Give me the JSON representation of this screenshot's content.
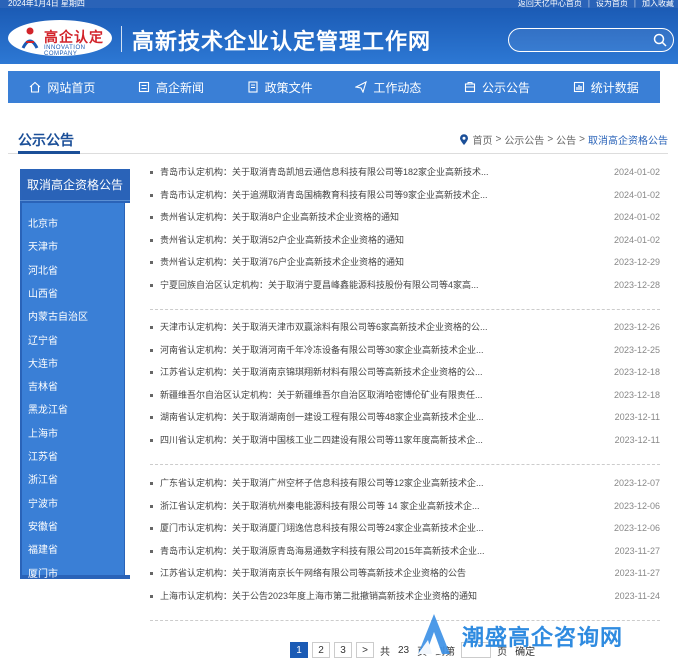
{
  "topbar": {
    "date": "2024年1月4日 星期四",
    "link_home": "返回天亿中心首页",
    "link_sethome": "设为首页",
    "link_fav": "加入收藏",
    "sep": "|"
  },
  "header": {
    "logo_text": "高企认定",
    "logo_sub": "INNOVATION COMPANY",
    "site_title": "高新技术企业认定管理工作网",
    "search_placeholder": ""
  },
  "nav": {
    "items": [
      {
        "label": "网站首页",
        "icon": "home-icon"
      },
      {
        "label": "高企新闻",
        "icon": "news-icon"
      },
      {
        "label": "政策文件",
        "icon": "document-icon"
      },
      {
        "label": "工作动态",
        "icon": "send-icon"
      },
      {
        "label": "公示公告",
        "icon": "notice-icon"
      },
      {
        "label": "统计数据",
        "icon": "chart-icon"
      }
    ]
  },
  "section": {
    "title": "公示公告",
    "breadcrumb": [
      "首页",
      "公示公告",
      "公告",
      "取消高企资格公告"
    ],
    "sep": ">"
  },
  "sidebar": {
    "head": "取消高企资格公告",
    "items": [
      "北京市",
      "天津市",
      "河北省",
      "山西省",
      "内蒙古自治区",
      "辽宁省",
      "大连市",
      "吉林省",
      "黑龙江省",
      "上海市",
      "江苏省",
      "浙江省",
      "宁波市",
      "安徽省",
      "福建省",
      "厦门市"
    ]
  },
  "list": {
    "groups": [
      [
        {
          "title": "青岛市认定机构：关于取消青岛凯旭云通信息科技有限公司等182家企业高新技术...",
          "date": "2024-01-02"
        },
        {
          "title": "青岛市认定机构：关于追溯取消青岛国楠教育科技有限公司等9家企业高新技术企...",
          "date": "2024-01-02"
        },
        {
          "title": "贵州省认定机构：关于取消8户企业高新技术企业资格的通知",
          "date": "2024-01-02"
        },
        {
          "title": "贵州省认定机构：关于取消52户企业高新技术企业资格的通知",
          "date": "2024-01-02"
        },
        {
          "title": "贵州省认定机构：关于取消76户企业高新技术企业资格的通知",
          "date": "2023-12-29"
        },
        {
          "title": "宁夏回族自治区认定机构：关于取消宁夏昌峰鑫能源科技股份有限公司等4家高...",
          "date": "2023-12-28"
        }
      ],
      [
        {
          "title": "天津市认定机构：关于取消天津市双赢涂料有限公司等6家高新技术企业资格的公...",
          "date": "2023-12-26"
        },
        {
          "title": "河南省认定机构：关于取消河南千年冷冻设备有限公司等30家企业高新技术企业...",
          "date": "2023-12-25"
        },
        {
          "title": "江苏省认定机构：关于取消南京锦琪翔新材料有限公司等高新技术企业资格的公...",
          "date": "2023-12-18"
        },
        {
          "title": "新疆维吾尔自治区认定机构：关于新疆维吾尔自治区取消哈密博伦矿业有限责任...",
          "date": "2023-12-18"
        },
        {
          "title": "湖南省认定机构：关于取消湖南创一建设工程有限公司等48家企业高新技术企业...",
          "date": "2023-12-11"
        },
        {
          "title": "四川省认定机构：关于取消中国核工业二四建设有限公司等11家年度高新技术企...",
          "date": "2023-12-11"
        }
      ],
      [
        {
          "title": "广东省认定机构：关于取消广州空杯子信息科技有限公司等12家企业高新技术企...",
          "date": "2023-12-07"
        },
        {
          "title": "浙江省认定机构：关于取消杭州秦电能源科技有限公司等 14 家企业高新技术企...",
          "date": "2023-12-06"
        },
        {
          "title": "厦门市认定机构：关于取消厦门翊逸信息科技有限公司等24家企业高新技术企业...",
          "date": "2023-12-06"
        },
        {
          "title": "青岛市认定机构：关于取消原青岛海易通数字科技有限公司2015年高新技术企业...",
          "date": "2023-11-27"
        },
        {
          "title": "江苏省认定机构：关于取消南京长午网络有限公司等高新技术企业资格的公告",
          "date": "2023-11-27"
        },
        {
          "title": "上海市认定机构：关于公告2023年度上海市第二批撤销高新技术企业资格的通知",
          "date": "2023-11-24"
        }
      ]
    ]
  },
  "pager": {
    "pages": [
      "1",
      "2",
      "3"
    ],
    "next": ">",
    "total_prefix": "共",
    "total": "23",
    "total_suffix": "页",
    "jump_label": "到第",
    "page_suffix": "页",
    "confirm": "确定"
  },
  "watermark": {
    "text": "潮盛高企咨询网"
  },
  "colors": {
    "primary": "#2a63b8",
    "nav": "#3a7fd6",
    "accent": "#1b4f98"
  }
}
